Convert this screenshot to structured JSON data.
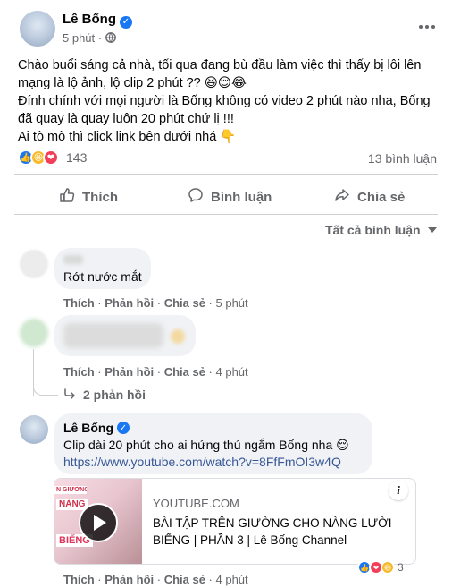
{
  "post": {
    "author": "Lê Bống",
    "time": "5 phút",
    "lines": [
      "Chào buổi sáng cả nhà, tối qua đang bù đầu làm việc thì thấy bị lôi lên",
      "mạng là lộ ảnh, lộ clip 2 phút ?? 😆😌😂",
      "Đính chính với mọi người là Bống không có video 2 phút nào nha, Bống",
      "đã quay là quay luôn 20 phút chứ lị !!!",
      "Ai tò mò thì click link bên dưới nhá 👇"
    ],
    "reaction_count": "143",
    "comment_count": "13 bình luận"
  },
  "buttons": {
    "like": "Thích",
    "comment": "Bình luận",
    "share": "Chia sẻ"
  },
  "filter": "Tất cả bình luận",
  "comments": [
    {
      "text": "Rớt nước mắt",
      "like": "Thích",
      "reply": "Phản hồi",
      "share": "Chia sẻ",
      "time": "5 phút"
    },
    {
      "like": "Thích",
      "reply": "Phản hồi",
      "share": "Chia sẻ",
      "time": "4 phút",
      "replies": "2 phản hồi"
    },
    {
      "author": "Lê Bống",
      "text": "Clip dài 20 phút cho ai hứng thú ngắm Bống nha 😌",
      "link": "https://www.youtube.com/watch?v=8FfFmOI3w4Q",
      "like": "Thích",
      "reply": "Phản hồi",
      "share": "Chia sẻ",
      "time": "4 phút",
      "reaction_count": "3"
    }
  ],
  "link_preview": {
    "domain": "YOUTUBE.COM",
    "title_line1": "BÀI TẬP TRÊN GIƯỜNG CHO NÀNG LƯỜI",
    "title_line2": "BIẾNG | PHẦN 3 | Lê Bống Channel",
    "thumb_text1": "NÀNG",
    "thumb_text2": "BIẾNG",
    "thumb_text_top": "N GIƯỜNG"
  },
  "colors": {
    "facebook_blue": "#1877f2",
    "link_blue": "#385898",
    "muted": "#65676b",
    "bubble": "#f0f2f5"
  }
}
